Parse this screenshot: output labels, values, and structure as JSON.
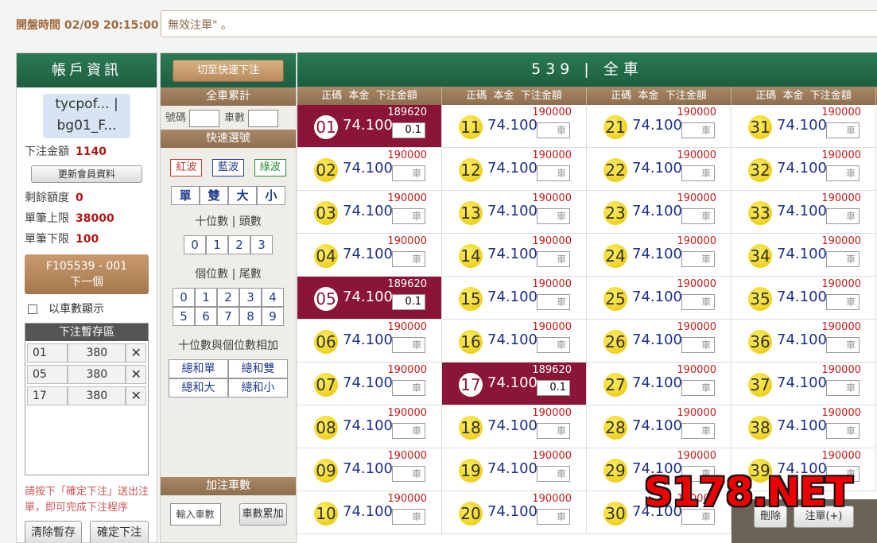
{
  "header": {
    "open_time_label": "開盤時間 02/09 20:15:00",
    "message": "無效注單\" 。"
  },
  "account": {
    "title": "帳戶資訊",
    "user_line1": "tycpof...",
    "user_sep": "|",
    "user_line2": "bg01_F...",
    "bet_amount_label": "下注金額",
    "bet_amount": "1140",
    "update_button": "更新會員資料",
    "remaining_label": "剩餘額度",
    "remaining": "0",
    "single_max_label": "單筆上限",
    "single_max": "38000",
    "single_min_label": "單筆下限",
    "single_min": "100",
    "next_line1": "F105539 - 001",
    "next_line2": "下一個",
    "show_by_count_label": "以車數顯示",
    "temp_title": "下注暫存區",
    "temp_rows": [
      {
        "num": "01",
        "amount": "380"
      },
      {
        "num": "05",
        "amount": "380"
      },
      {
        "num": "17",
        "amount": "380"
      }
    ],
    "hint": "請按下「確定下注」送出注單，即可完成下注程序",
    "clear_button": "清除暫存",
    "confirm_button": "確定下注"
  },
  "quick": {
    "fast_bet_button": "切至快速下注",
    "all_car_title": "全車累計",
    "num_label": "號碼",
    "car_count_label": "車數",
    "quick_select_title": "快速選號",
    "waves": [
      "紅波",
      "藍波",
      "綠波"
    ],
    "wave_colors": [
      "#c0392b",
      "#233a8c",
      "#2e8b3a"
    ],
    "parity": [
      "單",
      "雙",
      "大",
      "小"
    ],
    "tens_label": "十位數 | 頭數",
    "tens_digits": [
      "0",
      "1",
      "2",
      "3"
    ],
    "units_label": "個位數 | 尾數",
    "units_row1": [
      "0",
      "1",
      "2",
      "3",
      "4"
    ],
    "units_row2": [
      "5",
      "6",
      "7",
      "8",
      "9"
    ],
    "sum_label": "十位數與個位數相加",
    "sum_buttons": [
      "總和單",
      "總和雙",
      "總和大",
      "總和小"
    ],
    "add_title": "加注車數",
    "add_input_placeholder": "輸入車數",
    "add_button": "車數累加"
  },
  "main": {
    "title": "539 | 全車",
    "col_header": "正碼  本金  下注金額",
    "placeholder": "車",
    "cells": [
      {
        "n": "01",
        "odds": "74.100",
        "limit": "189620",
        "amount": "0.1",
        "sel": true
      },
      {
        "n": "11",
        "odds": "74.100",
        "limit": "190000",
        "amount": "",
        "sel": false
      },
      {
        "n": "21",
        "odds": "74.100",
        "limit": "190000",
        "amount": "",
        "sel": false
      },
      {
        "n": "31",
        "odds": "74.100",
        "limit": "190000",
        "amount": "",
        "sel": false
      },
      {
        "n": "02",
        "odds": "74.100",
        "limit": "190000",
        "amount": "",
        "sel": false
      },
      {
        "n": "12",
        "odds": "74.100",
        "limit": "190000",
        "amount": "",
        "sel": false
      },
      {
        "n": "22",
        "odds": "74.100",
        "limit": "190000",
        "amount": "",
        "sel": false
      },
      {
        "n": "32",
        "odds": "74.100",
        "limit": "190000",
        "amount": "",
        "sel": false
      },
      {
        "n": "03",
        "odds": "74.100",
        "limit": "190000",
        "amount": "",
        "sel": false
      },
      {
        "n": "13",
        "odds": "74.100",
        "limit": "190000",
        "amount": "",
        "sel": false
      },
      {
        "n": "23",
        "odds": "74.100",
        "limit": "190000",
        "amount": "",
        "sel": false
      },
      {
        "n": "33",
        "odds": "74.100",
        "limit": "190000",
        "amount": "",
        "sel": false
      },
      {
        "n": "04",
        "odds": "74.100",
        "limit": "190000",
        "amount": "",
        "sel": false
      },
      {
        "n": "14",
        "odds": "74.100",
        "limit": "190000",
        "amount": "",
        "sel": false
      },
      {
        "n": "24",
        "odds": "74.100",
        "limit": "190000",
        "amount": "",
        "sel": false
      },
      {
        "n": "34",
        "odds": "74.100",
        "limit": "190000",
        "amount": "",
        "sel": false
      },
      {
        "n": "05",
        "odds": "74.100",
        "limit": "189620",
        "amount": "0.1",
        "sel": true
      },
      {
        "n": "15",
        "odds": "74.100",
        "limit": "190000",
        "amount": "",
        "sel": false
      },
      {
        "n": "25",
        "odds": "74.100",
        "limit": "190000",
        "amount": "",
        "sel": false
      },
      {
        "n": "35",
        "odds": "74.100",
        "limit": "190000",
        "amount": "",
        "sel": false
      },
      {
        "n": "06",
        "odds": "74.100",
        "limit": "190000",
        "amount": "",
        "sel": false
      },
      {
        "n": "16",
        "odds": "74.100",
        "limit": "190000",
        "amount": "",
        "sel": false
      },
      {
        "n": "26",
        "odds": "74.100",
        "limit": "190000",
        "amount": "",
        "sel": false
      },
      {
        "n": "36",
        "odds": "74.100",
        "limit": "190000",
        "amount": "",
        "sel": false
      },
      {
        "n": "07",
        "odds": "74.100",
        "limit": "190000",
        "amount": "",
        "sel": false
      },
      {
        "n": "17",
        "odds": "74.100",
        "limit": "189620",
        "amount": "0.1",
        "sel": true
      },
      {
        "n": "27",
        "odds": "74.100",
        "limit": "190000",
        "amount": "",
        "sel": false
      },
      {
        "n": "37",
        "odds": "74.100",
        "limit": "190000",
        "amount": "",
        "sel": false
      },
      {
        "n": "08",
        "odds": "74.100",
        "limit": "190000",
        "amount": "",
        "sel": false
      },
      {
        "n": "18",
        "odds": "74.100",
        "limit": "190000",
        "amount": "",
        "sel": false
      },
      {
        "n": "28",
        "odds": "74.100",
        "limit": "190000",
        "amount": "",
        "sel": false
      },
      {
        "n": "38",
        "odds": "74.100",
        "limit": "190000",
        "amount": "",
        "sel": false
      },
      {
        "n": "09",
        "odds": "74.100",
        "limit": "190000",
        "amount": "",
        "sel": false
      },
      {
        "n": "19",
        "odds": "74.100",
        "limit": "190000",
        "amount": "",
        "sel": false
      },
      {
        "n": "29",
        "odds": "74.100",
        "limit": "190000",
        "amount": "",
        "sel": false
      },
      {
        "n": "39",
        "odds": "74.100",
        "limit": "190000",
        "amount": "",
        "sel": false
      },
      {
        "n": "10",
        "odds": "74.100",
        "limit": "190000",
        "amount": "",
        "sel": false
      },
      {
        "n": "20",
        "odds": "74.100",
        "limit": "190000",
        "amount": "",
        "sel": false
      },
      {
        "n": "30",
        "odds": "74.100",
        "limit": "190000",
        "amount": "",
        "sel": false
      }
    ],
    "delete_button": "刪除",
    "add_bet_button": "注單(+)",
    "selected_color": "#8b1536"
  },
  "watermark": "S178.NET"
}
